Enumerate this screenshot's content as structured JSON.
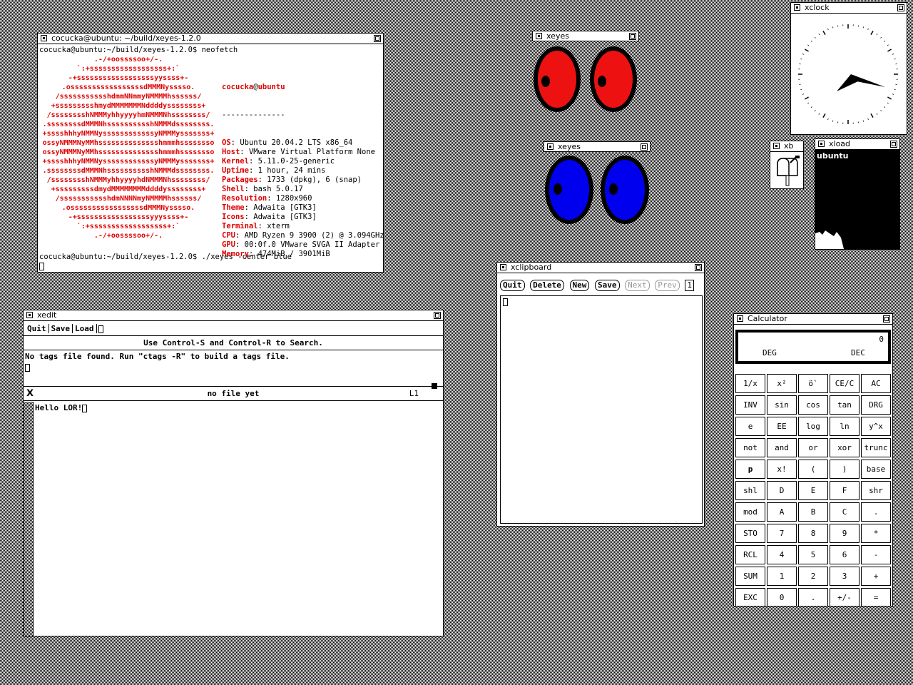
{
  "terminal": {
    "title": "cocucka@ubuntu: ~/build/xeyes-1.2.0",
    "prompt1": "cocucka@ubuntu:~/build/xeyes-1.2.0$ neofetch",
    "user": "cocucka",
    "at": "@",
    "host": "ubuntu",
    "separator": "--------------",
    "info": [
      {
        "k": "OS",
        "v": "Ubuntu 20.04.2 LTS x86_64"
      },
      {
        "k": "Host",
        "v": "VMware Virtual Platform None"
      },
      {
        "k": "Kernel",
        "v": "5.11.0-25-generic"
      },
      {
        "k": "Uptime",
        "v": "1 hour, 24 mins"
      },
      {
        "k": "Packages",
        "v": "1733 (dpkg), 6 (snap)"
      },
      {
        "k": "Shell",
        "v": "bash 5.0.17"
      },
      {
        "k": "Resolution",
        "v": "1280x960"
      },
      {
        "k": "Theme",
        "v": "Adwaita [GTK3]"
      },
      {
        "k": "Icons",
        "v": "Adwaita [GTK3]"
      },
      {
        "k": "Terminal",
        "v": "xterm"
      },
      {
        "k": "CPU",
        "v": "AMD Ryzen 9 3900 (2) @ 3.094GHz"
      },
      {
        "k": "GPU",
        "v": "00:0f.0 VMware SVGA II Adapter"
      },
      {
        "k": "Memory",
        "v": "474MiB / 3901MiB"
      }
    ],
    "logo": [
      ".-/+oossssoo+/-.",
      "`:+ssssssssssssssssss+:`",
      "-+ssssssssssssssssssyyssss+-",
      ".osssssssssssssssssdMMMNysssso.",
      "/ssssssssssshdmmNNmmyNMMMMhssssss/",
      "+ssssssssshmydMMMMMMMNddddyssssssss+",
      "/sssssssshNMMMyhhyyyyhmNMMMNhssssssss/",
      ".ssssssssdMMMNhsssssssssshNMMMdssssssss.",
      "+sssshhhyNMMNyssssssssssssyNMMMysssssss+",
      "ossyNMMMNyMMhsssssssssssssshmmmhssssssso",
      "ossyNMMMNyMMhsssssssssssssshmmmhssssssso",
      "+sssshhhyNMMNyssssssssssssyNMMMysssssss+",
      ".ssssssssdMMMNhsssssssssshNMMMdssssssss.",
      "/sssssssshNMMMyhhyyyyhdNMMMNhssssssss/",
      "+sssssssssdmydMMMMMMMMddddyssssssss+",
      "/ssssssssssshdmNNNNmyNMMMMhssssss/",
      ".osssssssssssssssssdMMMNysssso.",
      "-+sssssssssssssssssyyyssss+-",
      "`:+ssssssssssssssssss+:`",
      ".-/+oossssoo+/-."
    ],
    "swatches_top": [
      "#000000",
      "#cd0000",
      "#00cd00",
      "#cdcd00",
      "#0000ee",
      "#cd00cd",
      "#00cdcd",
      "#e5e5e5"
    ],
    "swatches_bottom": [
      "#7f7f7f",
      "#ff0000",
      "#00ff00",
      "#ffff00",
      "#5c5cff",
      "#ff00ff",
      "#00ffff",
      "#ffffff"
    ],
    "prompt2": "cocucka@ubuntu:~/build/xeyes-1.2.0$ ./xeyes -center blue"
  },
  "xeyes_red": {
    "title": "xeyes",
    "color": "#ee1111"
  },
  "xeyes_blue": {
    "title": "xeyes",
    "color": "#0000ee"
  },
  "xclock": {
    "title": "xclock"
  },
  "xbiff": {
    "title": "xb"
  },
  "xload": {
    "title": "xload",
    "host": "ubuntu"
  },
  "xclipboard": {
    "title": "xclipboard",
    "buttons": [
      "Quit",
      "Delete",
      "New",
      "Save"
    ],
    "disabled": [
      "Next",
      "Prev"
    ],
    "index": "1"
  },
  "xedit": {
    "title": "xedit",
    "buttons": [
      "Quit",
      "Save",
      "Load"
    ],
    "hint": "Use Control-S and Control-R to Search.",
    "message": "No tags file found. Run \"ctags -R\" to build a tags file.",
    "filename": "no file yet",
    "line": "L1",
    "content": "Hello LOR!"
  },
  "calculator": {
    "title": "Calculator",
    "display": "0",
    "deg": "DEG",
    "dec": "DEC",
    "keys": [
      [
        "1/x",
        "x²",
        "ö`",
        "CE/C",
        "AC"
      ],
      [
        "INV",
        "sin",
        "cos",
        "tan",
        "DRG"
      ],
      [
        "e",
        "EE",
        "log",
        "ln",
        "y^x"
      ],
      [
        "not",
        "and",
        "or",
        "xor",
        "trunc"
      ],
      [
        "p",
        "x!",
        "(",
        ")",
        "base"
      ],
      [
        "shl",
        "D",
        "E",
        "F",
        "shr"
      ],
      [
        "mod",
        "A",
        "B",
        "C",
        "."
      ],
      [
        "STO",
        "7",
        "8",
        "9",
        "*"
      ],
      [
        "RCL",
        "4",
        "5",
        "6",
        "-"
      ],
      [
        "SUM",
        "1",
        "2",
        "3",
        "+"
      ],
      [
        "EXC",
        "0",
        ".",
        "+/-",
        "="
      ]
    ]
  }
}
